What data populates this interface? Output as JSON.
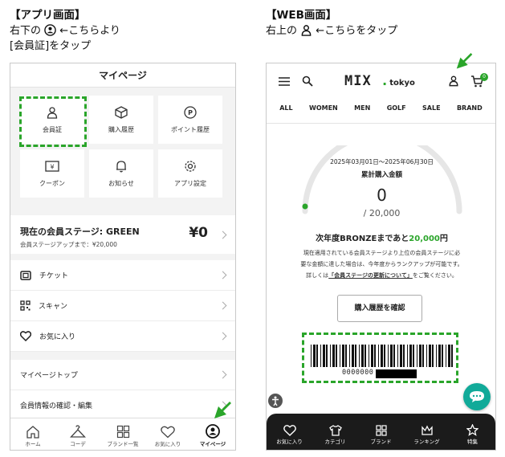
{
  "captions": {
    "app_head": "【アプリ画面】",
    "app_line1_pre": "右下の",
    "app_line1_post": "←こちらより",
    "app_line2": "[会員証]をタップ",
    "web_head": "【WEB画面】",
    "web_line1_pre": "右上の",
    "web_line1_post": "←こちらをタップ"
  },
  "app": {
    "title": "マイページ",
    "tiles": [
      {
        "label": "会員証",
        "icon": "person-icon"
      },
      {
        "label": "購入履歴",
        "icon": "box-icon"
      },
      {
        "label": "ポイント履歴",
        "icon": "point-icon"
      },
      {
        "label": "クーポン",
        "icon": "coupon-icon"
      },
      {
        "label": "お知らせ",
        "icon": "bell-icon"
      },
      {
        "label": "アプリ設定",
        "icon": "gear-icon"
      }
    ],
    "stage": {
      "title": "現在の会員ステージ: GREEN",
      "subtitle": "会員ステージアップまで：¥20,000",
      "amount": "¥0"
    },
    "menu": [
      {
        "label": "チケット",
        "icon": "ticket-icon"
      },
      {
        "label": "スキャン",
        "icon": "qr-icon"
      },
      {
        "label": "お気に入り",
        "icon": "heart-icon"
      }
    ],
    "menu2": [
      {
        "label": "マイページトップ"
      },
      {
        "label": "会員情報の確認・編集"
      }
    ],
    "tabs": [
      {
        "label": "ホーム",
        "icon": "home-icon"
      },
      {
        "label": "コーデ",
        "icon": "hanger-icon"
      },
      {
        "label": "ブランド一覧",
        "icon": "grid-icon"
      },
      {
        "label": "お気に入り",
        "icon": "heart-icon"
      },
      {
        "label": "マイページ",
        "icon": "account-icon"
      }
    ]
  },
  "web": {
    "logo_main": "MIX",
    "logo_sub": "tokyo",
    "cart_count": "0",
    "categories": [
      "ALL",
      "WOMEN",
      "MEN",
      "GOLF",
      "SALE",
      "BRAND"
    ],
    "period": "2025年03月01日〜2025年06月30日",
    "cumulative_label": "累計購入金額",
    "amount": "0",
    "goal": "/ 20,000",
    "next_pre": "次年度BRONZEまであと",
    "next_amount": "20,000",
    "next_post": "円",
    "info1": "現在適用されている会員ステージより上位の会員ステージに必",
    "info2": "要な金額に達した場合は、今年度からランクアップが可能です。",
    "info3_pre": "詳しくは",
    "info3_link": "「会員ステージの更新について」",
    "info3_post": "をご覧ください。",
    "history_button": "購入履歴を確認",
    "barcode_number": "0000000",
    "nav": [
      {
        "label": "お気に入り",
        "icon": "heart-icon"
      },
      {
        "label": "カテゴリ",
        "icon": "shirt-icon"
      },
      {
        "label": "ブランド",
        "icon": "grid-icon"
      },
      {
        "label": "ランキング",
        "icon": "crown-icon"
      },
      {
        "label": "特集",
        "icon": "star-icon"
      }
    ],
    "accent": "#2aa52a"
  }
}
